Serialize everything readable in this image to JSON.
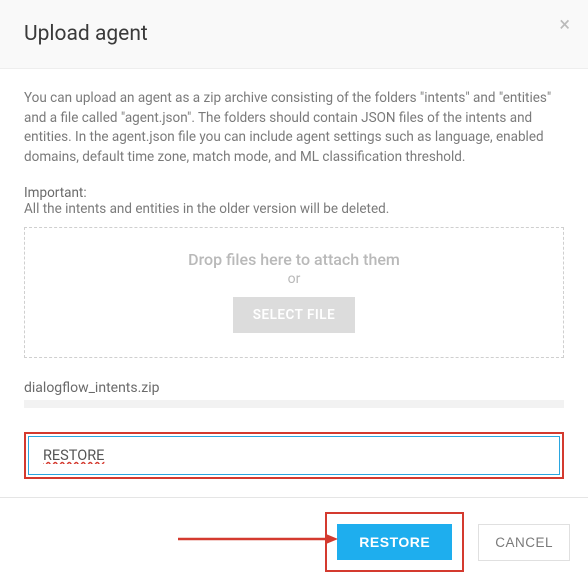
{
  "header": {
    "title": "Upload agent"
  },
  "body": {
    "description": "You can upload an agent as a zip archive consisting of the folders \"intents\" and \"entities\" and a file called \"agent.json\". The folders should contain JSON files of the intents and entities. In the agent.json file you can include agent settings such as language, enabled domains, default time zone, match mode, and ML classification threshold.",
    "important_label": "Important:",
    "important_text": "All the intents and entities in the older version will be deleted.",
    "dropzone": {
      "main": "Drop files here to attach them",
      "or": "or",
      "select_file": "SELECT FILE"
    },
    "filename": "dialogflow_intents.zip",
    "confirm_value": "RESTORE"
  },
  "footer": {
    "restore": "RESTORE",
    "cancel": "CANCEL"
  }
}
